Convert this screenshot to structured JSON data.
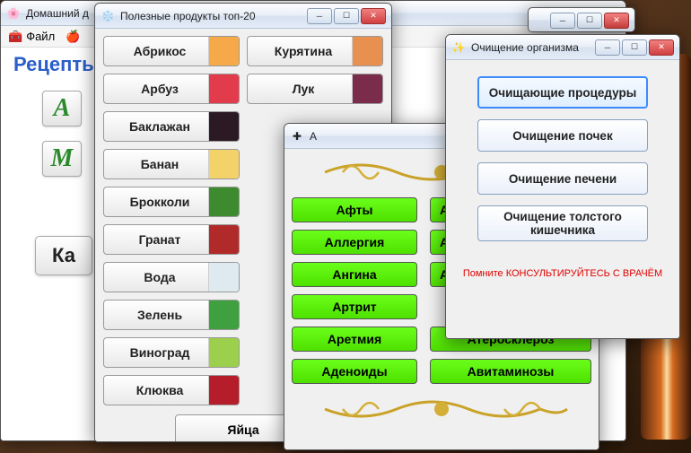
{
  "winA": {
    "title": "Домашний д",
    "menu_file": "Файл",
    "heading": "Рецепть",
    "letters": [
      "A",
      "M"
    ],
    "big_button": "Ка"
  },
  "winB": {
    "title": "Полезные продукты топ-20",
    "products_left": [
      "Абрикос",
      "Арбуз",
      "Баклажан",
      "Банан",
      "Брокколи",
      "Гранат",
      "Вода",
      "Зелень",
      "Виноград",
      "Клюква"
    ],
    "products_right": [
      "Курятина",
      "Лук"
    ],
    "bottom": "Яйца",
    "thumb_colors_left": [
      "#f5a948",
      "#e23b4c",
      "#2b1a24",
      "#f4d26a",
      "#3d8a2f",
      "#b12a2a",
      "#dfeaf0",
      "#3fa03f",
      "#9bcf4c",
      "#b61d2a"
    ],
    "thumb_colors_right": [
      "#e89050",
      "#7a2c4a"
    ]
  },
  "winC": {
    "title": "А",
    "left": [
      "Афты",
      "Аллергия",
      "Ангина",
      "Артрит",
      "Аретмия",
      "Аденоиды"
    ],
    "right_trunc": [
      "А",
      "Аст",
      "Ап"
    ],
    "right_full": [
      "Атеросклероз",
      "Авитаминозы"
    ]
  },
  "winD": {
    "title": "Очищение организма",
    "buttons": [
      "Очищающие процедуры",
      "Очищение почек",
      "Очищение печени",
      "Очищение толстого кишечника"
    ],
    "footer": "Помните КОНСУЛЬТИРУЙТЕСЬ С ВРАЧЁМ"
  }
}
